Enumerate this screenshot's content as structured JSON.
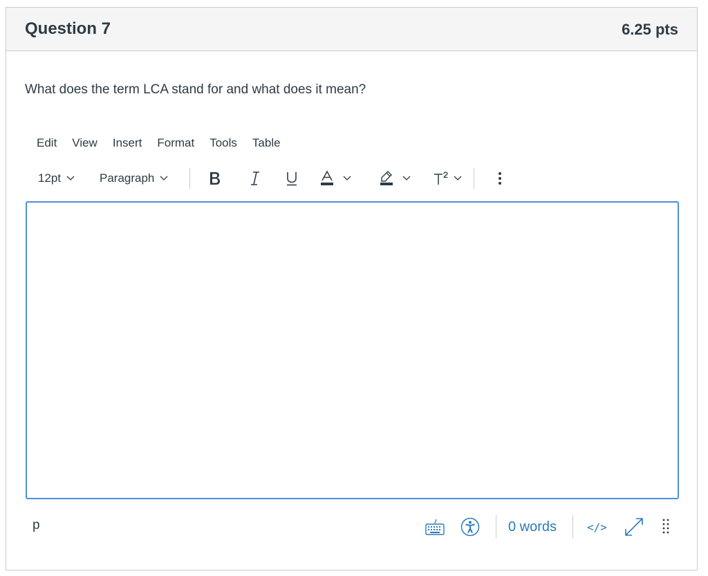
{
  "question": {
    "title": "Question 7",
    "points": "6.25 pts",
    "text": "What does the term LCA stand for and what does it mean?"
  },
  "menubar": [
    "Edit",
    "View",
    "Insert",
    "Format",
    "Tools",
    "Table"
  ],
  "toolbar": {
    "font_size": "12pt",
    "block_format": "Paragraph",
    "icons": [
      "bold-icon",
      "italic-icon",
      "underline-icon",
      "text-color-icon",
      "highlight-color-icon",
      "superscript-icon",
      "more-options-icon"
    ]
  },
  "editor": {
    "content": ""
  },
  "statusbar": {
    "path": "p",
    "word_count": "0 words",
    "html_toggle": "</>",
    "icons": [
      "keyboard-icon",
      "accessibility-icon",
      "html-editor-icon",
      "fullscreen-icon",
      "resize-handle-icon"
    ]
  },
  "colors": {
    "accent": "#2b7abc",
    "text": "#2d3b45",
    "border": "#c7cdd1",
    "editor_border": "#4a90d9",
    "header_bg": "#f5f5f5"
  }
}
